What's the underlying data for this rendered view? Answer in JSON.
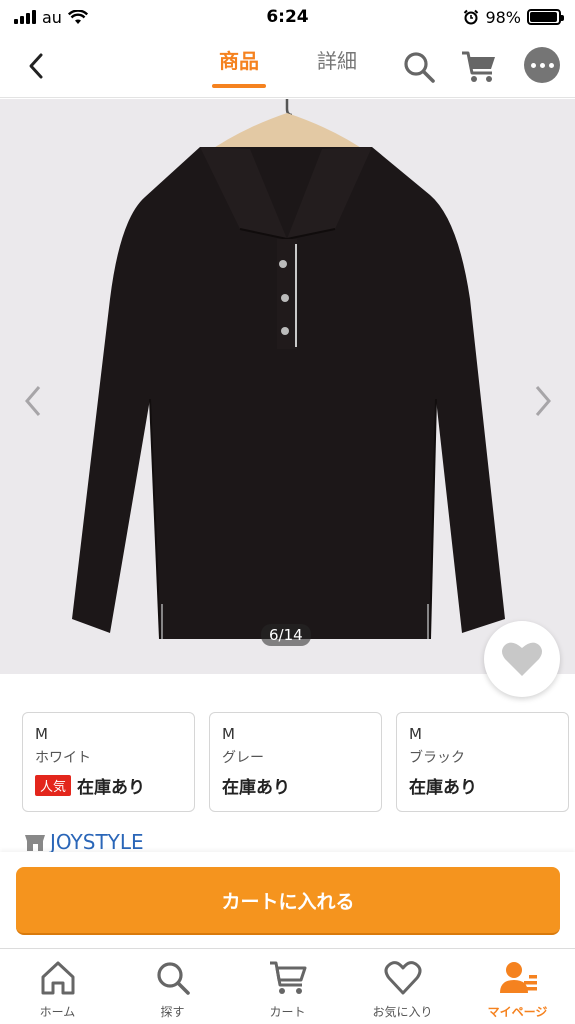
{
  "status_bar": {
    "carrier": "au",
    "time": "6:24",
    "battery_percent": "98%",
    "battery_level": 0.98
  },
  "header": {
    "tabs": [
      {
        "label": "商品",
        "active": true
      },
      {
        "label": "詳細",
        "active": false
      }
    ],
    "icons": [
      "chevron-left-icon",
      "search-icon",
      "cart-icon",
      "more-icon"
    ]
  },
  "product": {
    "page_counter": "6/14",
    "image_description_icon": "black-polo-shirt"
  },
  "variants": [
    {
      "size": "M",
      "color": "ホワイト",
      "badge": "人気",
      "stock": "在庫あり"
    },
    {
      "size": "M",
      "color": "グレー",
      "badge": "",
      "stock": "在庫あり"
    },
    {
      "size": "M",
      "color": "ブラック",
      "badge": "",
      "stock": "在庫あり"
    }
  ],
  "store": {
    "name": "JOYSTYLE"
  },
  "cart": {
    "add_label": "カートに入れる"
  },
  "bottom_nav": {
    "items": [
      {
        "label": "ホーム",
        "icon": "home-icon",
        "active": false
      },
      {
        "label": "探す",
        "icon": "search-icon",
        "active": false
      },
      {
        "label": "カート",
        "icon": "cart-icon",
        "active": false
      },
      {
        "label": "お気に入り",
        "icon": "heart-icon",
        "active": false
      },
      {
        "label": "マイページ",
        "icon": "user-icon",
        "active": true
      }
    ]
  },
  "colors": {
    "accent": "#f5821f",
    "button": "#f5941e",
    "badge": "#e3261c",
    "link": "#2a66b8"
  }
}
